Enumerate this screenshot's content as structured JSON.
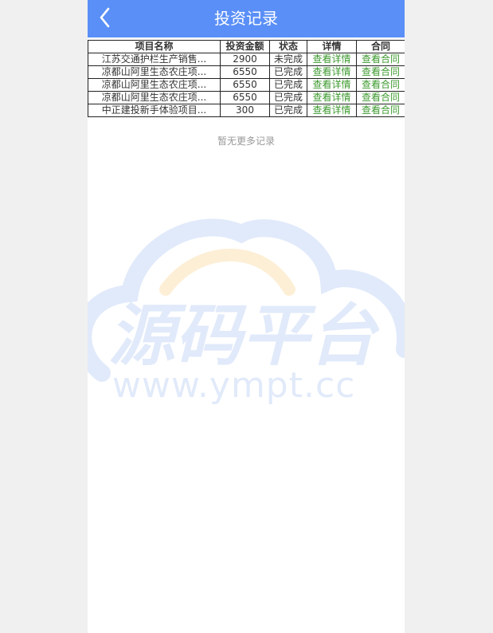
{
  "header": {
    "title": "投资记录"
  },
  "table": {
    "columns": [
      "项目名称",
      "投资金额",
      "状态",
      "详情",
      "合同"
    ],
    "rows": [
      {
        "name": "江苏交通护栏生产销售...",
        "amount": "2900",
        "status": "未完成",
        "detail": "查看详情",
        "contract": "查看合同"
      },
      {
        "name": "凉都山阿里生态农庄项...",
        "amount": "6550",
        "status": "已完成",
        "detail": "查看详情",
        "contract": "查看合同"
      },
      {
        "name": "凉都山阿里生态农庄项...",
        "amount": "6550",
        "status": "已完成",
        "detail": "查看详情",
        "contract": "查看合同"
      },
      {
        "name": "凉都山阿里生态农庄项...",
        "amount": "6550",
        "status": "已完成",
        "detail": "查看详情",
        "contract": "查看合同"
      },
      {
        "name": "中正建投新手体验项目...",
        "amount": "300",
        "status": "已完成",
        "detail": "查看详情",
        "contract": "查看合同"
      }
    ]
  },
  "footer": {
    "no_more": "暂无更多记录"
  },
  "watermark": {
    "logo_text": "源码平台",
    "url": "www.ympt.cc"
  },
  "colors": {
    "header_bg": "#5a8ff7",
    "link": "#3d9a2f",
    "page_bg": "#f0f0f0"
  }
}
